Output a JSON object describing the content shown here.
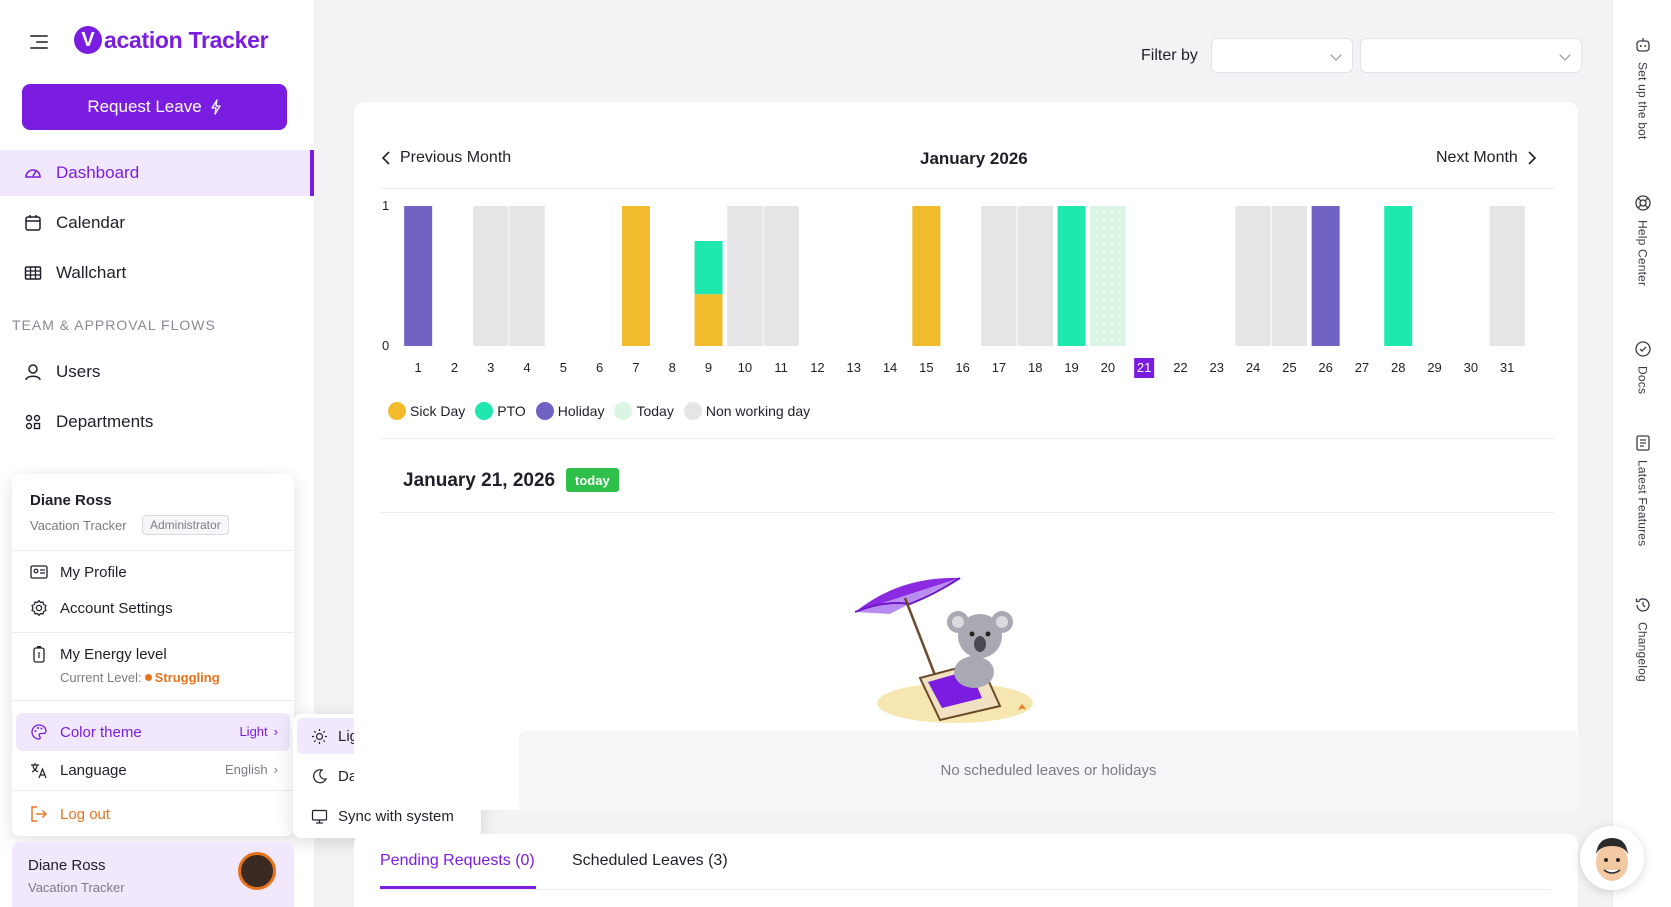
{
  "app": {
    "logo_letter": "V",
    "logo_text": "acation Tracker",
    "request_leave_label": "Request Leave"
  },
  "sidebar": {
    "items": [
      {
        "label": "Dashboard",
        "icon": "gauge-icon"
      },
      {
        "label": "Calendar",
        "icon": "calendar-icon"
      },
      {
        "label": "Wallchart",
        "icon": "grid-icon"
      }
    ],
    "section_title": "TEAM & APPROVAL FLOWS",
    "team_items": [
      {
        "label": "Users",
        "icon": "user-icon"
      },
      {
        "label": "Departments",
        "icon": "departments-icon"
      }
    ]
  },
  "profile_menu": {
    "name": "Diane Ross",
    "org": "Vacation Tracker",
    "role": "Administrator",
    "my_profile": "My Profile",
    "account_settings": "Account Settings",
    "energy_label": "My Energy level",
    "current_level_label": "Current Level:",
    "current_level_value": "Struggling",
    "color_theme_label": "Color theme",
    "color_theme_value": "Light",
    "language_label": "Language",
    "language_value": "English",
    "logout_label": "Log out"
  },
  "theme_menu": {
    "options": [
      "Light",
      "Dark",
      "Sync with system"
    ]
  },
  "user_footer": {
    "name": "Diane Ross",
    "org": "Vacation Tracker"
  },
  "filter": {
    "label": "Filter by"
  },
  "calendar": {
    "prev_label": "Previous Month",
    "next_label": "Next Month",
    "month_title": "January 2026",
    "day_title": "January 21, 2026",
    "today_badge": "today",
    "empty_text": "No scheduled leaves or holidays"
  },
  "tabs": {
    "pending": "Pending Requests (0)",
    "scheduled": "Scheduled Leaves (3)"
  },
  "right_rail": [
    "Set up the bot",
    "Help Center",
    "Docs",
    "Latest Features",
    "Changelog"
  ],
  "colors": {
    "accent": "#7a1de0",
    "sick": "#f2bb2e",
    "pto": "#1ee8ad",
    "holiday": "#7163c4",
    "today": "#d9f5e4",
    "non_working": "#e5e5e7"
  },
  "chart_data": {
    "type": "bar",
    "stacked": true,
    "categories": [
      "1",
      "2",
      "3",
      "4",
      "5",
      "6",
      "7",
      "8",
      "9",
      "10",
      "11",
      "12",
      "13",
      "14",
      "15",
      "16",
      "17",
      "18",
      "19",
      "20",
      "21",
      "22",
      "23",
      "24",
      "25",
      "26",
      "27",
      "28",
      "29",
      "30",
      "31"
    ],
    "series": [
      {
        "name": "Sick Day",
        "color": "#f2bb2e",
        "values": [
          0,
          0,
          0,
          0,
          0,
          0,
          1,
          0,
          0.37,
          0,
          0,
          0,
          0,
          0,
          1,
          0,
          0,
          0,
          0,
          0,
          0,
          0,
          0,
          0,
          0,
          0,
          0,
          0,
          0,
          0,
          0
        ]
      },
      {
        "name": "PTO",
        "color": "#1ee8ad",
        "values": [
          0,
          0,
          0,
          0,
          0,
          0,
          0,
          0,
          0.38,
          0,
          0,
          0,
          0,
          0,
          0,
          0,
          0,
          0,
          1,
          0,
          0,
          0,
          0,
          0,
          0,
          0,
          0,
          1,
          0,
          0,
          0
        ]
      },
      {
        "name": "Holiday",
        "color": "#7163c4",
        "values": [
          1,
          0,
          0,
          0,
          0,
          0,
          0,
          0,
          0,
          0,
          0,
          0,
          0,
          0,
          0,
          0,
          0,
          0,
          0,
          0,
          0,
          0,
          0,
          0,
          0,
          1,
          0,
          0,
          0,
          0,
          0
        ]
      },
      {
        "name": "Today",
        "color": "#d9f5e4",
        "values": [
          0,
          0,
          0,
          0,
          0,
          0,
          0,
          0,
          0,
          0,
          0,
          0,
          0,
          0,
          0,
          0,
          0,
          0,
          0,
          1,
          0,
          0,
          0,
          0,
          0,
          0,
          0,
          0,
          0,
          0,
          0
        ]
      },
      {
        "name": "Non working day",
        "color": "#e5e5e7",
        "values": [
          0,
          0,
          1,
          1,
          0,
          0,
          0,
          0,
          0,
          1,
          1,
          0,
          0,
          0,
          0,
          0,
          1,
          1,
          0,
          0,
          0,
          0,
          0,
          1,
          1,
          0,
          0,
          0,
          0,
          0,
          1
        ]
      }
    ],
    "highlight_category": "21",
    "ylim": [
      0,
      1
    ],
    "yticks": [
      "0",
      "1"
    ],
    "legend": [
      "Sick Day",
      "PTO",
      "Holiday",
      "Today",
      "Non working day"
    ],
    "legend_position": "bottom-left"
  }
}
